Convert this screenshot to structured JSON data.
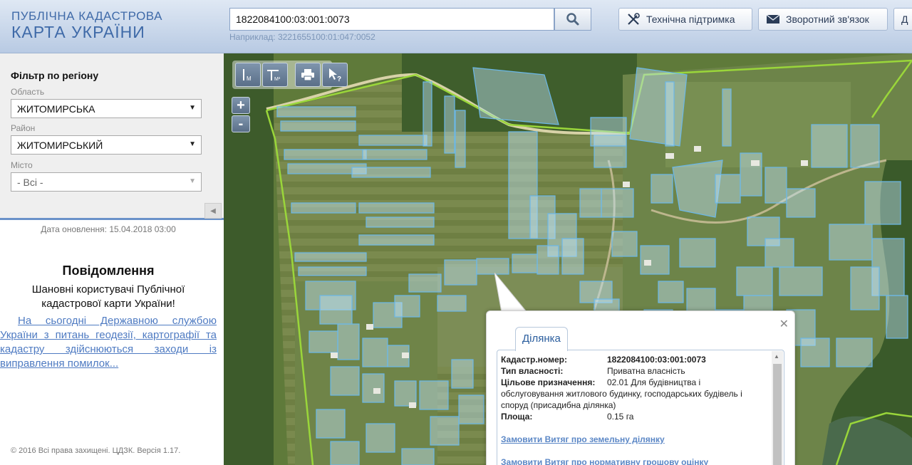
{
  "header": {
    "logo_line1": "ПУБЛІЧНА КАДАСТРОВА",
    "logo_line2": "КАРТА УКРАЇНИ",
    "search_value": "1822084100:03:001:0073",
    "search_hint": "Наприклад: 3221655100:01:047:0052",
    "support_label": "Технічна підтримка",
    "feedback_label": "Зворотний зв'язок",
    "third_button_label": "Д"
  },
  "sidebar": {
    "filter_title": "Фільтр по регіону",
    "oblast_label": "Область",
    "oblast_value": "ЖИТОМИРСЬКА",
    "raion_label": "Район",
    "raion_value": "ЖИТОМИРСЬКИЙ",
    "city_label": "Місто",
    "city_value": "- Всі -",
    "update_date": "Дата оновлення: 15.04.2018 03:00",
    "message_title": "Повідомлення",
    "message_greeting": "Шановні користувачі Публічної кадастрової карти України!",
    "message_link": "На сьогодні Державною службою України з питань геодезії, картографії та кадастру здійснюються заходи із виправлення помилок...",
    "copyright": "© 2016 Всі права захищені. ЦДЗК. Версія 1.17."
  },
  "map": {
    "tools": [
      {
        "name": "measure-distance-tool",
        "label": "М"
      },
      {
        "name": "measure-area-tool",
        "label": "М²"
      },
      {
        "name": "print-tool",
        "label": ""
      },
      {
        "name": "identify-tool",
        "label": "?"
      }
    ],
    "zoom_in": "+",
    "zoom_out": "-"
  },
  "popup": {
    "tab_label": "Ділянка",
    "cadastral_label": "Кадастр.номер:",
    "cadastral_value": "1822084100:03:001:0073",
    "ownership_label": "Тип власності:",
    "ownership_value": "Приватна власність",
    "purpose_label": "Цільове призначення:",
    "purpose_value": "02.01 Для будівництва і",
    "purpose_value_cont": "обслуговування житлового будинку, господарських будівель і споруд (присадибна ділянка)",
    "area_label": "Площа:",
    "area_value": "0.15 га",
    "link1": "Замовити Витяг про земельну ділянку",
    "link2": "Замовити Витяг про нормативну грошову оцінку",
    "close_symbol": "✕"
  },
  "colors": {
    "brand": "#3f6aa8",
    "parcel_fill": "#bfe3f7",
    "parcel_stroke": "#6bb8e8",
    "boundary": "#9ad63a",
    "link": "#4f7bc2"
  }
}
